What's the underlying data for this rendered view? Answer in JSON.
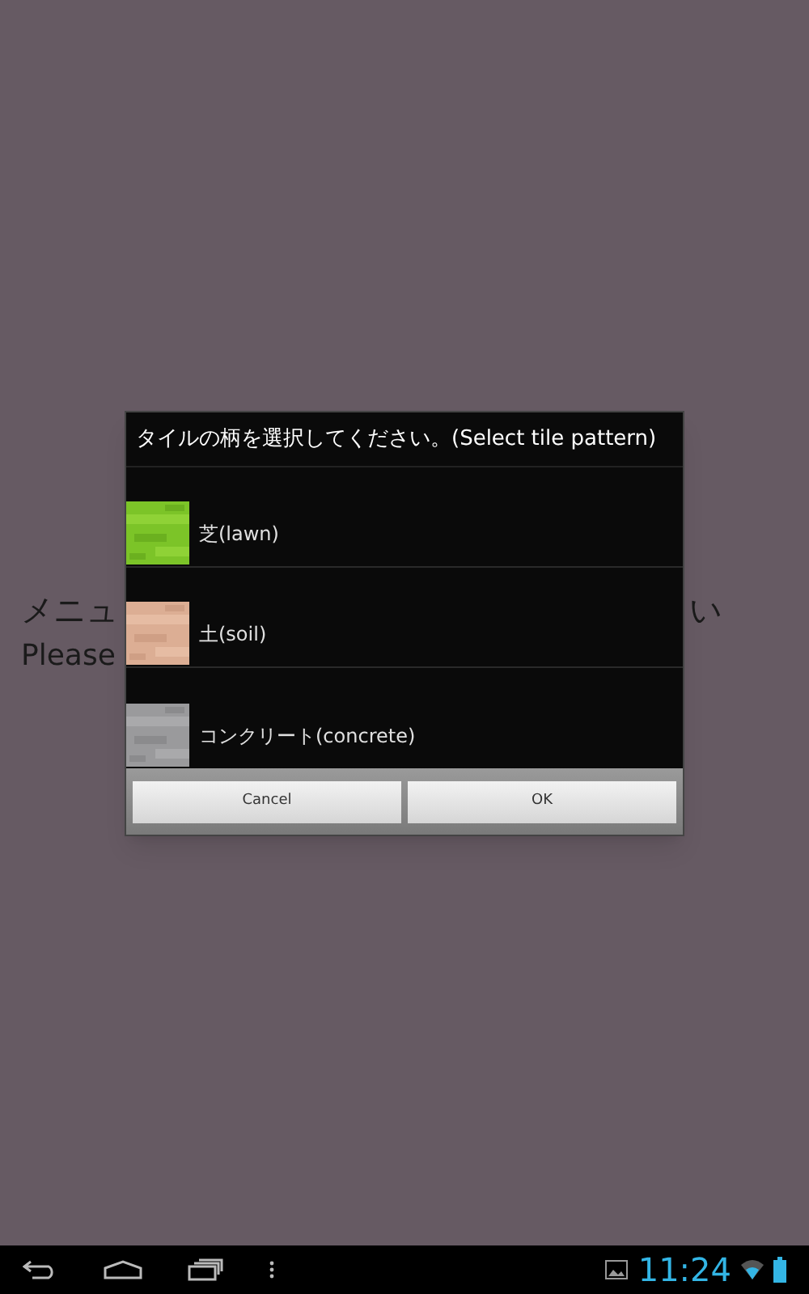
{
  "background_text": {
    "japanese_left": "メニュ",
    "japanese_right": "い",
    "english": "Please"
  },
  "dialog": {
    "title": "タイルの柄を選択してください。(Select tile pattern)",
    "items": [
      {
        "label": "芝(lawn)",
        "kind": "lawn"
      },
      {
        "label": "土(soil)",
        "kind": "soil"
      },
      {
        "label": "コンクリート(concrete)",
        "kind": "concrete"
      }
    ],
    "buttons": [
      "Cancel",
      "OK"
    ]
  },
  "status_bar": {
    "time": "11:24"
  }
}
